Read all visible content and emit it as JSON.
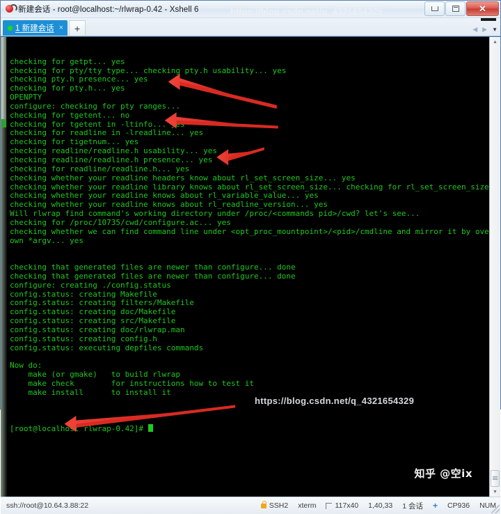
{
  "window": {
    "title": "新建会话 - root@localhost:~/rlwrap-0.42 - Xshell 6",
    "icon": "xshell-logo-icon",
    "controls": {
      "minimize": "−",
      "maximize": "□",
      "close": "✕"
    }
  },
  "tabbar": {
    "tab": {
      "label": "1 新建会话",
      "close": "×",
      "status": "connected"
    },
    "new_tab": "+",
    "nav_prev": "◀",
    "nav_next": "▶",
    "dropdown": "▼"
  },
  "terminal": {
    "lines": [
      "checking for getpt... yes",
      "checking for pty/tty type... checking pty.h usability... yes",
      "checking pty.h presence... yes",
      "checking for pty.h... yes",
      "OPENPTY",
      "configure: checking for pty ranges...",
      "checking for tgetent... no",
      "checking for tgetent in -ltinfo... yes",
      "checking for readline in -lreadline... yes",
      "checking for tigetnum... yes",
      "checking readline/readline.h usability... yes",
      "checking readline/readline.h presence... yes",
      "checking for readline/readline.h... yes",
      "checking whether your readline headers know about rl_set_screen_size... yes",
      "checking whether your readline library knows about rl_set_screen_size... checking for rl_set_screen_size... yes",
      "checking whether your readline knows about rl_variable_value... yes",
      "checking whether your readline knows about rl_readline_version... yes",
      "Will rlwrap find command's working directory under /proc/<commands pid>/cwd? let's see...",
      "checking for /proc/10735/cwd/configure.ac... yes",
      "checking whether we can find command line under <opt_proc_mountpoint>/<pid>/cmdline and mirror it by overwriting our",
      "own *argv... yes",
      "",
      "",
      "checking that generated files are newer than configure... done",
      "checking that generated files are newer than configure... done",
      "configure: creating ./config.status",
      "config.status: creating Makefile",
      "config.status: creating filters/Makefile",
      "config.status: creating doc/Makefile",
      "config.status: creating src/Makefile",
      "config.status: creating doc/rlwrap.man",
      "config.status: creating config.h",
      "config.status: executing depfiles commands",
      "",
      "Now do:",
      "    make (or gmake)   to build rlwrap",
      "    make check        for instructions how to test it",
      "    make install      to install it",
      ""
    ],
    "prompt": "[root@localhost rlwrap-0.42]# ",
    "foreground_color": "#1ec81e",
    "background_color": "#000000",
    "annotation_arrows": 4,
    "annotation_color": "#e8352b"
  },
  "statusbar": {
    "connection": "ssh://root@10.64.3.88:22",
    "protocol": "SSH2",
    "terminal_type": "xterm",
    "size": "117x40",
    "cursor_position": "1,40,33",
    "sessions": "1 会话",
    "encoding": "CP936",
    "num_lock": "NUM"
  },
  "watermarks": {
    "zhihu": "知乎 @空ix",
    "url": "https://blog.csdn.net/q_4321654329"
  }
}
